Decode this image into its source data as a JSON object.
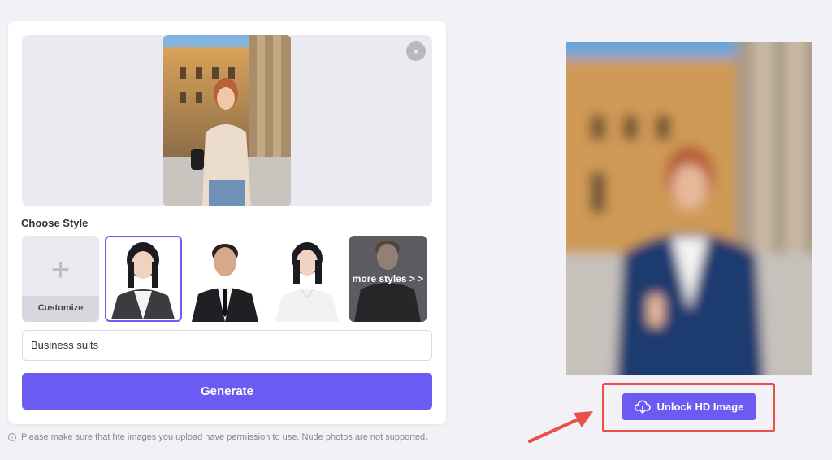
{
  "panel": {
    "choose_style_label": "Choose Style",
    "close_icon": "×",
    "customize_label": "Customize",
    "customize_icon": "+",
    "more_styles_label": "more styles > >",
    "style_input_value": "Business suits",
    "generate_label": "Generate"
  },
  "notice": {
    "icon": "i",
    "text": "Please make sure that hte images you upload have permission to use. Nude photos are not supported."
  },
  "result": {
    "unlock_label": "Unlock HD Image",
    "unlock_icon": "cloud-download-icon"
  },
  "colors": {
    "accent": "#6b5bf2",
    "highlight": "#e9504a",
    "background": "#f2f1f6"
  }
}
